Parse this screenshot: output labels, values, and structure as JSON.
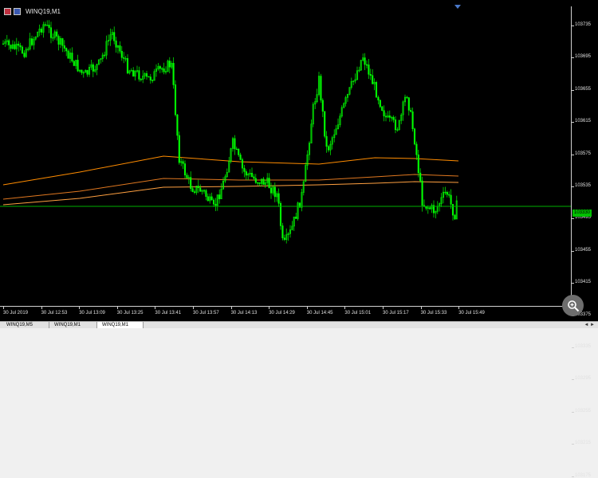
{
  "window": {
    "title": "WINQ19,M1"
  },
  "price_axis": {
    "labels": [
      "103735",
      "103695",
      "103655",
      "103615",
      "103575",
      "103535",
      "103495",
      "103455",
      "103415",
      "103375",
      "103335",
      "103295",
      "103255",
      "103215",
      "103175"
    ],
    "current_price": "103330"
  },
  "time_axis": {
    "labels": [
      "30 Jul 2019",
      "30 Jul 12:53",
      "30 Jul 13:09",
      "30 Jul 13:25",
      "30 Jul 13:41",
      "30 Jul 13:57",
      "30 Jul 14:13",
      "30 Jul 14:29",
      "30 Jul 14:45",
      "30 Jul 15:01",
      "30 Jul 15:17",
      "30 Jul 15:33",
      "30 Jul 15:49"
    ]
  },
  "tabs": [
    {
      "label": "WINQ19,M5",
      "active": false
    },
    {
      "label": "WINQ19,M1",
      "active": false
    },
    {
      "label": "WINQ19,M1",
      "active": true
    }
  ],
  "tab_nav": "◄ ►",
  "colors": {
    "background": "#000000",
    "candles": "#00ff00",
    "moving_averages": [
      "#ff8c00",
      "#e07820",
      "#ffa040"
    ],
    "current_price_line": "#00b000"
  },
  "icons": {
    "zoom": "magnifier-plus-icon"
  }
}
